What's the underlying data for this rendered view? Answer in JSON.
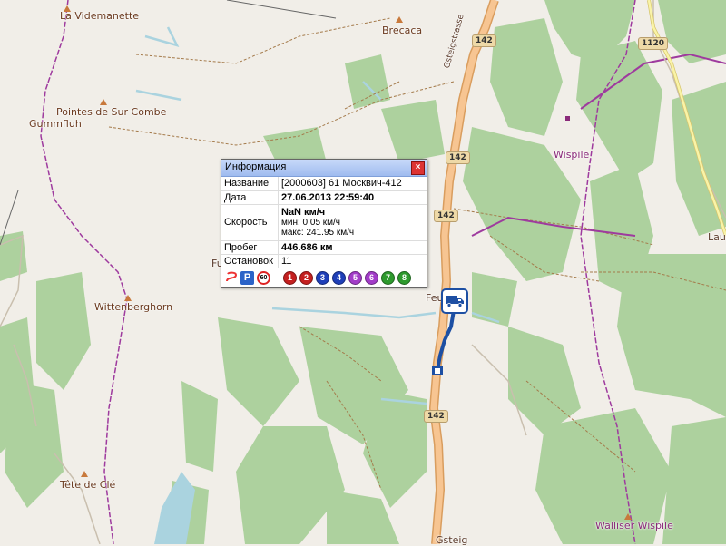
{
  "map": {
    "labels": {
      "vidmanette": "La Videmanette",
      "brecaca": "Brecaca",
      "pointes": "Pointes de Sur Combe",
      "gummfluh": "Gummfluh",
      "wispile": "Wispile",
      "laue": "Laue",
      "fu": "Fu",
      "feu": "Feu",
      "wittenberghorn": "Wittenberghorn",
      "tete": "Tête de Clé",
      "walliser": "Walliser Wispile",
      "gsteig": "Gsteig",
      "road_name": "Gsteigstrasse"
    },
    "shields": {
      "r142a": "142",
      "r142b": "142",
      "r142c": "142",
      "r142d": "142",
      "r1120": "1120"
    },
    "colors": {
      "forest": "#add19e",
      "road": "#f7c592",
      "route": "#1d4fa3",
      "boundary": "#9e3a9e",
      "water": "#aad3df"
    }
  },
  "info": {
    "title": "Информация",
    "close_label": "×",
    "rows": {
      "name_label": "Название",
      "name_value": "[2000603] 61 Москвич-412",
      "date_label": "Дата",
      "date_value": "27.06.2013 22:59:40",
      "speed_label": "Скорость",
      "speed_value": "NaN км/ч",
      "speed_min": "мин: 0.05 км/ч",
      "speed_max": "макс: 241.95 км/ч",
      "mileage_label": "Пробег",
      "mileage_value": "446.686 км",
      "stops_label": "Остановок",
      "stops_value": "11"
    },
    "toolbar": {
      "parking_label": "P",
      "speed_label": "60",
      "numbers": [
        "1",
        "2",
        "3",
        "4",
        "5",
        "6",
        "7",
        "8"
      ],
      "number_colors": [
        "#c42020",
        "#c42020",
        "#1f3fb8",
        "#1f3fb8",
        "#a23cc8",
        "#a23cc8",
        "#2e9a2e",
        "#2e9a2e"
      ]
    }
  }
}
